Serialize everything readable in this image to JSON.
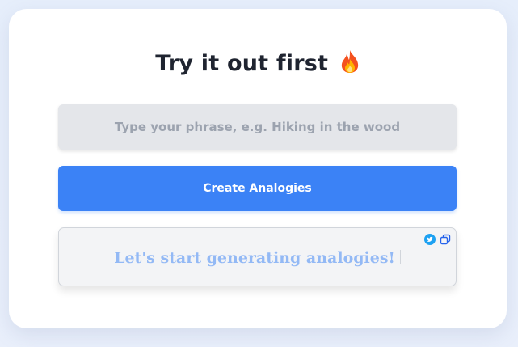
{
  "card": {
    "title": "Try it out first",
    "title_icon": "fire-icon"
  },
  "phrase_input": {
    "value": "",
    "placeholder": "Type your phrase, e.g. Hiking in the wood"
  },
  "create_button": {
    "label": "Create Analogies"
  },
  "output": {
    "text": "Let's start generating analogies!",
    "share_icon": "twitter-icon",
    "copy_icon": "copy-icon"
  },
  "colors": {
    "accent": "#3b82f6",
    "twitter": "#1da1f2",
    "output_text": "#93b9f5"
  }
}
